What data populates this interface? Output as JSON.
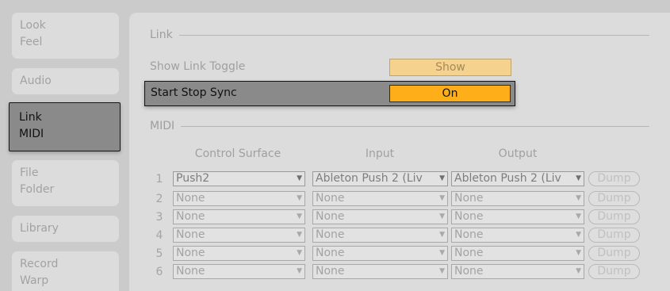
{
  "sidebar": {
    "tabs": [
      {
        "lines": [
          "Look",
          "Feel"
        ],
        "active": false
      },
      {
        "lines": [
          "Audio"
        ],
        "active": false
      },
      {
        "lines": [
          "Link",
          "MIDI"
        ],
        "active": true
      },
      {
        "lines": [
          "File",
          "Folder"
        ],
        "active": false
      },
      {
        "lines": [
          "Library"
        ],
        "active": false
      },
      {
        "lines": [
          "Record",
          "Warp"
        ],
        "active": false
      }
    ]
  },
  "link_section": {
    "title": "Link",
    "show_link_toggle": {
      "label": "Show Link Toggle",
      "value": "Show"
    },
    "start_stop_sync": {
      "label": "Start Stop Sync",
      "value": "On"
    }
  },
  "midi_section": {
    "title": "MIDI",
    "columns": {
      "control_surface": "Control Surface",
      "input": "Input",
      "output": "Output"
    },
    "rows": [
      {
        "num": "1",
        "surface": "Push2",
        "input": "Ableton Push 2 (Liv",
        "output": "Ableton Push 2 (Liv",
        "dump": "Dump"
      },
      {
        "num": "2",
        "surface": "None",
        "input": "None",
        "output": "None",
        "dump": "Dump"
      },
      {
        "num": "3",
        "surface": "None",
        "input": "None",
        "output": "None",
        "dump": "Dump"
      },
      {
        "num": "4",
        "surface": "None",
        "input": "None",
        "output": "None",
        "dump": "Dump"
      },
      {
        "num": "5",
        "surface": "None",
        "input": "None",
        "output": "None",
        "dump": "Dump"
      },
      {
        "num": "6",
        "surface": "None",
        "input": "None",
        "output": "None",
        "dump": "Dump"
      }
    ],
    "dropdown_arrow": "▼"
  },
  "colors": {
    "background": "#cbcbcb",
    "panel": "#dcdcdc",
    "active_tab": "#8a8a8a",
    "on_button": "#fdae18",
    "show_button": "#f5d38e"
  }
}
